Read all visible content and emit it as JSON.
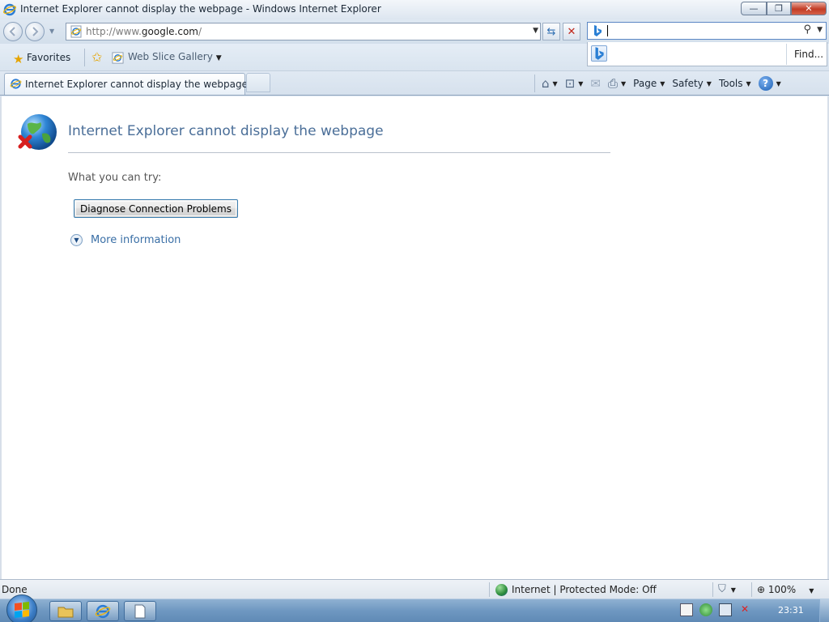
{
  "window": {
    "title": "Internet Explorer cannot display the webpage - Windows Internet Explorer",
    "minimize_glyph": "—",
    "restore_glyph": "❐",
    "close_glyph": "✕"
  },
  "address": {
    "url_prefix": "http://www.",
    "url_domain": "google.com",
    "url_suffix": "/"
  },
  "search": {
    "provider_icon": "bing-icon",
    "find_label": "Find..."
  },
  "favorites_bar": {
    "favorites_label": "Favorites",
    "web_slice_gallery_label": "Web Slice Gallery"
  },
  "tab": {
    "title": "Internet Explorer cannot display the webpage"
  },
  "command_bar": {
    "page_label": "Page",
    "safety_label": "Safety",
    "tools_label": "Tools",
    "help_glyph": "?"
  },
  "error_page": {
    "title": "Internet Explorer cannot display the webpage",
    "try_heading": "What you can try:",
    "diagnose_button": "Diagnose Connection Problems",
    "more_information": "More information"
  },
  "status_bar": {
    "status": "Done",
    "zone": "Internet | Protected Mode: Off",
    "zoom": "100%"
  },
  "taskbar": {
    "clock": "23:31"
  },
  "colors": {
    "accent_blue": "#4a6e98",
    "link_blue": "#3a6fa6",
    "close_red": "#c23b24"
  }
}
